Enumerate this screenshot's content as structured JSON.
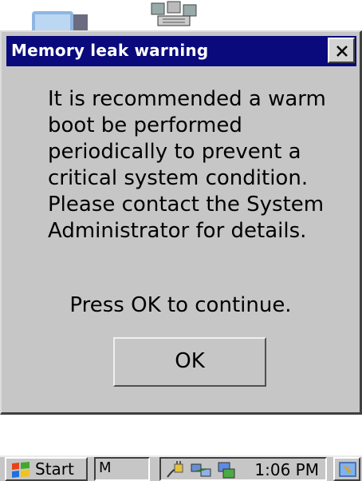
{
  "desktop": {
    "icons": [
      "my-computer-icon",
      "network-neighborhood-icon"
    ]
  },
  "dialog": {
    "title": "Memory leak warning",
    "close_label": "×",
    "message_lines": [
      "It is recommended a warm",
      "boot be performed",
      "periodically to prevent a",
      "critical system condition.",
      "Please contact the System",
      "Administrator for details."
    ],
    "press_ok_text": "Press OK to continue.",
    "ok_label": "OK"
  },
  "taskbar": {
    "start_label": "Start",
    "task_item_label": "M",
    "tray_icons": [
      "power-plug-icon",
      "network-connection-icon",
      "network-sync-icon"
    ],
    "clock": "1:06 PM",
    "desktop_icon": "show-desktop-icon"
  },
  "colors": {
    "titlebar": "#0a0a7c",
    "dialog_bg": "#c7c6c6",
    "title_text": "#ffffff"
  }
}
